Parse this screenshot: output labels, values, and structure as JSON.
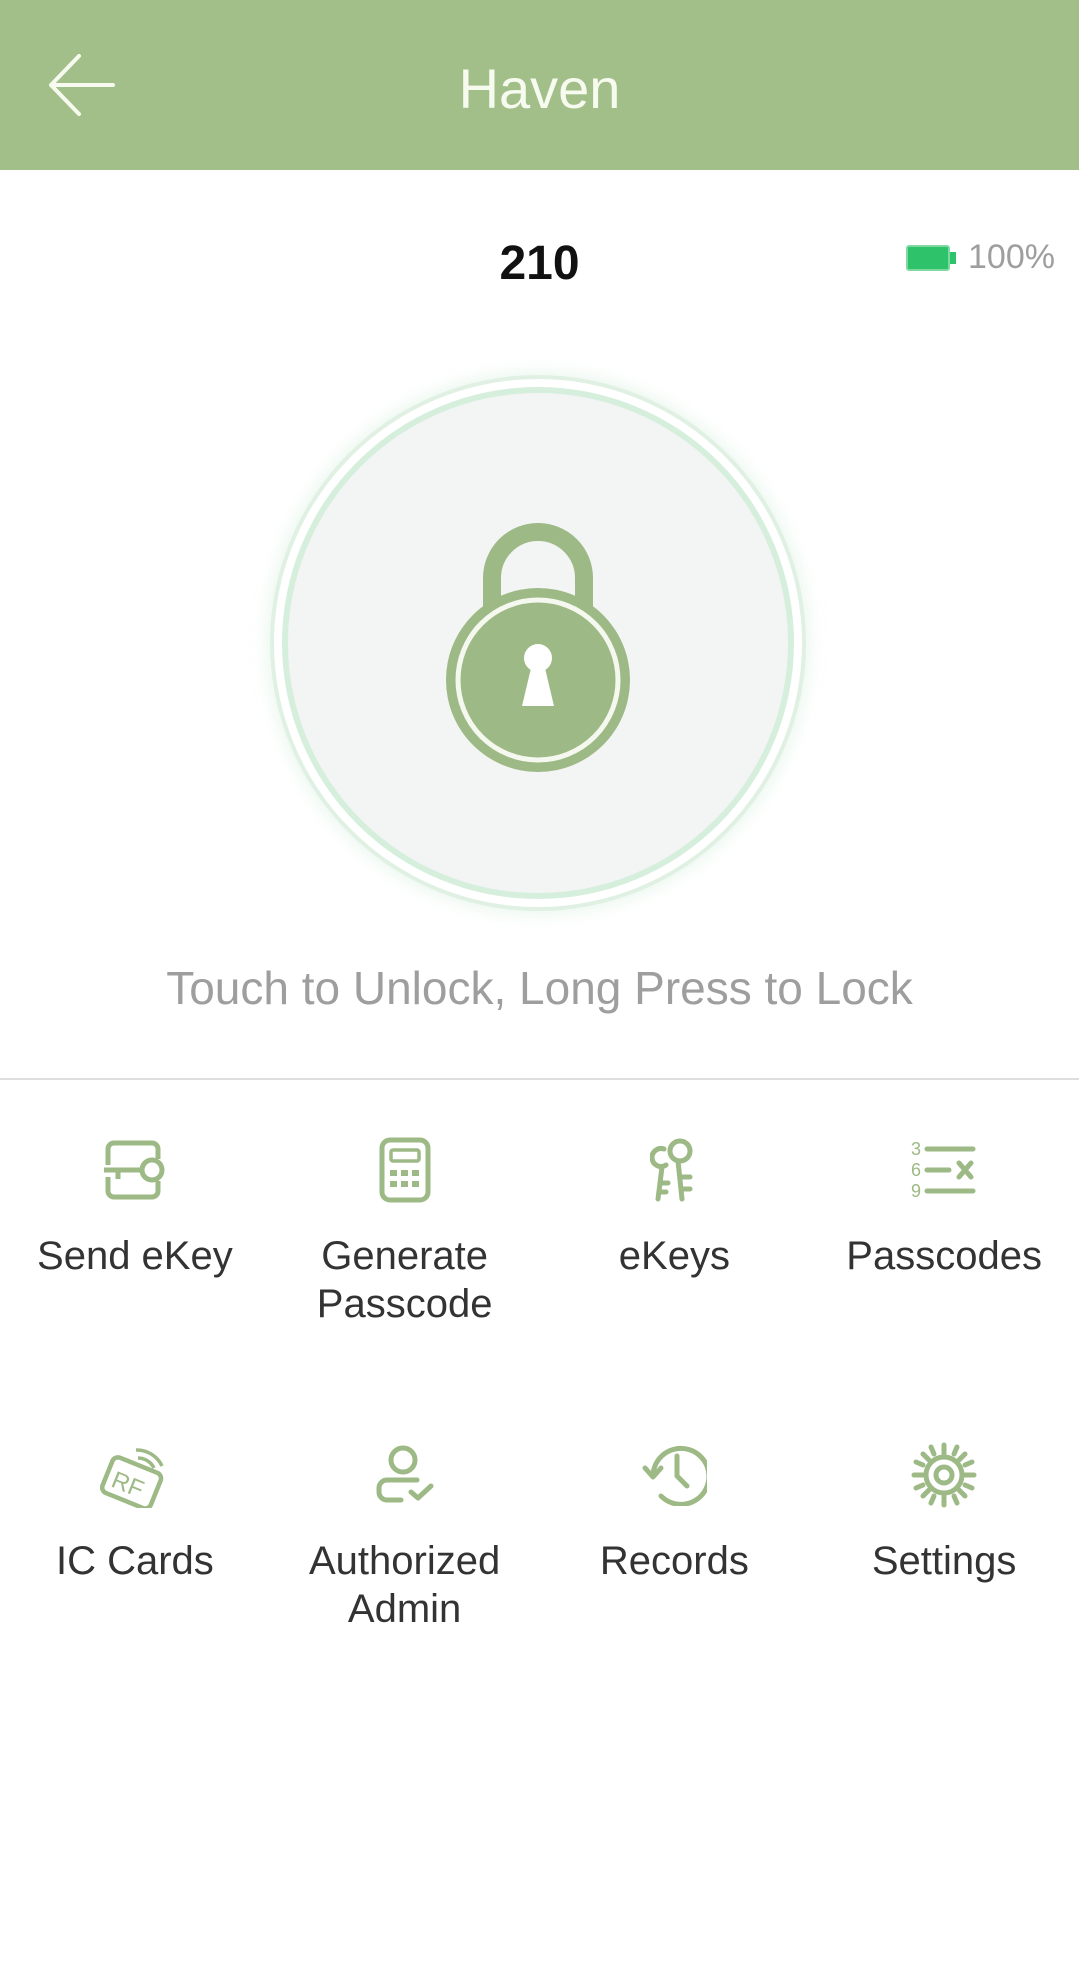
{
  "header": {
    "title": "Haven",
    "back_icon": "arrow-left-icon"
  },
  "lock": {
    "name": "210",
    "battery_percent": "100%",
    "battery_level": 1.0,
    "status_icon": "padlock-icon",
    "hint": "Touch to Unlock, Long Press to Lock"
  },
  "colors": {
    "accent": "#a2bf8a",
    "battery": "#2ec26a",
    "hint_text": "#9e9e9e"
  },
  "menu": [
    {
      "label": "Send eKey",
      "icon": "send-ekey-icon"
    },
    {
      "label": "Generate Passcode",
      "icon": "calculator-icon"
    },
    {
      "label": "eKeys",
      "icon": "keys-icon"
    },
    {
      "label": "Passcodes",
      "icon": "passcode-list-icon"
    },
    {
      "label": "IC Cards",
      "icon": "rf-card-icon"
    },
    {
      "label": "Authorized Admin",
      "icon": "user-check-icon"
    },
    {
      "label": "Records",
      "icon": "history-icon"
    },
    {
      "label": "Settings",
      "icon": "gear-icon"
    }
  ]
}
